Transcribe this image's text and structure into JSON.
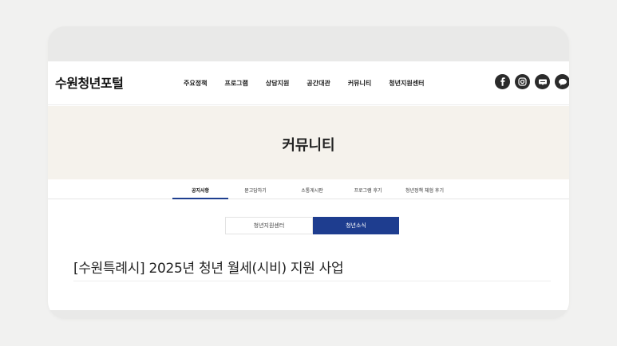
{
  "site": {
    "logo": "수원청년포털",
    "nav": [
      "주요정책",
      "프로그램",
      "상담지원",
      "공간대관",
      "커뮤니티",
      "청년지원센터"
    ],
    "sns_icons": [
      "facebook-icon",
      "instagram-icon",
      "blog-icon",
      "talk-icon"
    ]
  },
  "hero": {
    "title": "커뮤니티"
  },
  "subtabs": {
    "items": [
      "공지사항",
      "묻고답하기",
      "소통게시판",
      "프로그램 후기",
      "청년정책 체험 후기"
    ],
    "active_index": 0
  },
  "toggle": {
    "left": "청년지원센터",
    "right": "청년소식",
    "active": "청년소식"
  },
  "article": {
    "title": "[수원특례시] 2025년 청년 월세(시비) 지원 사업"
  },
  "colors": {
    "accent": "#1e3d8f",
    "hero_bg": "#f5f2ec",
    "icon_bg": "#2b2b2b"
  }
}
